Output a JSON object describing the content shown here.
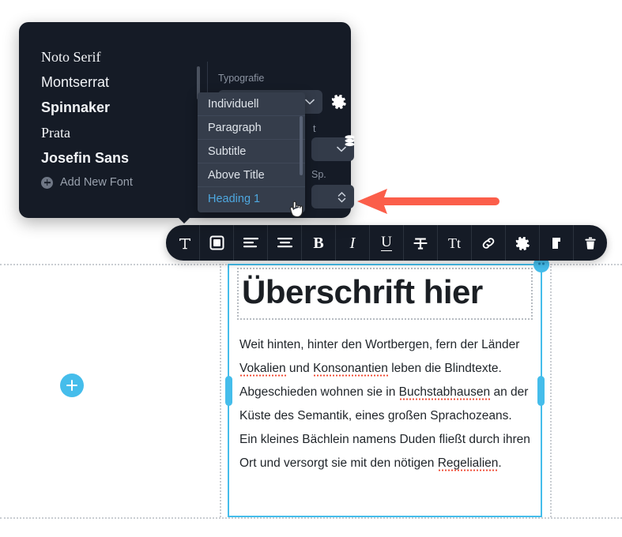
{
  "settings_panel": {
    "fonts": [
      {
        "name": "Noto Serif"
      },
      {
        "name": "Montserrat"
      },
      {
        "name": "Spinnaker"
      },
      {
        "name": "Prata"
      },
      {
        "name": "Josefin Sans"
      }
    ],
    "add_font_label": "Add New Font",
    "typography_label": "Typografie",
    "typography_value": "Heading 1",
    "schrift_label": "t",
    "spacing_label": "Sp.",
    "dropdown_options": [
      {
        "label": "Individuell",
        "selected": false
      },
      {
        "label": "Paragraph",
        "selected": false
      },
      {
        "label": "Subtitle",
        "selected": false
      },
      {
        "label": "Above Title",
        "selected": false
      },
      {
        "label": "Heading 1",
        "selected": true
      }
    ]
  },
  "format_toolbar": {
    "buttons": [
      {
        "icon": "text-format-icon",
        "label": "T"
      },
      {
        "icon": "shape-box-icon",
        "label": ""
      },
      {
        "icon": "align-left-icon",
        "label": ""
      },
      {
        "icon": "align-center-icon",
        "label": ""
      },
      {
        "icon": "bold-icon",
        "label": "B"
      },
      {
        "icon": "italic-icon",
        "label": "I"
      },
      {
        "icon": "underline-icon",
        "label": "U"
      },
      {
        "icon": "strikethrough-icon",
        "label": "T"
      },
      {
        "icon": "text-case-icon",
        "label": "Tt"
      },
      {
        "icon": "link-icon",
        "label": ""
      },
      {
        "icon": "gear-icon",
        "label": ""
      },
      {
        "icon": "duplicate-icon",
        "label": ""
      },
      {
        "icon": "trash-icon",
        "label": ""
      }
    ]
  },
  "content": {
    "heading": "Überschrift hier",
    "paragraph_parts": [
      {
        "text": "Weit hinten, hinter den Wortbergen, fern der Länder ",
        "misspelled": false
      },
      {
        "text": "Vokalien",
        "misspelled": true
      },
      {
        "text": " und ",
        "misspelled": false
      },
      {
        "text": "Konsonantien",
        "misspelled": true
      },
      {
        "text": " leben die Blindtexte. Abgeschieden wohnen sie in ",
        "misspelled": false
      },
      {
        "text": "Buchstabhausen",
        "misspelled": true
      },
      {
        "text": " an der Küste des Semantik, eines großen Sprachozeans. Ein kleines Bächlein namens Duden fließt durch ihren Ort und versorgt sie mit den nötigen ",
        "misspelled": false
      },
      {
        "text": "Regelialien",
        "misspelled": true
      },
      {
        "text": ".",
        "misspelled": false
      }
    ]
  },
  "canvas": {
    "add_block_icon": "plus-icon"
  },
  "annotation": {
    "arrow_icon": "left-arrow-icon",
    "arrow_color": "#fb5e4a"
  },
  "colors": {
    "accent_blue": "#45bdeb",
    "panel_dark": "#151b26",
    "dropdown_bg": "#353d4b",
    "selected_text": "#4ea8e0"
  }
}
